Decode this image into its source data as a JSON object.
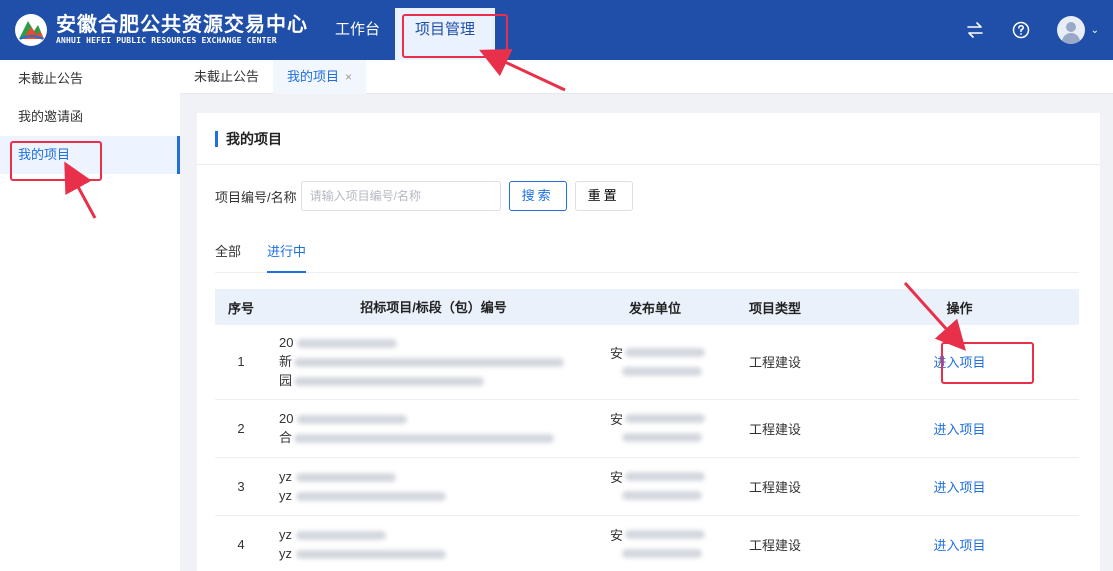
{
  "header": {
    "logo_cn": "安徽合肥公共资源交易中心",
    "logo_en": "ANHUI HEFEI PUBLIC RESOURCES EXCHANGE CENTER",
    "nav": [
      "工作台",
      "项目管理"
    ],
    "active_nav": "项目管理",
    "icons": [
      "swap-icon",
      "help-circle-icon",
      "user-avatar",
      "chevron-down-icon"
    ]
  },
  "sidebar": {
    "items": [
      "未截止公告",
      "我的邀请函",
      "我的项目"
    ],
    "active": "我的项目"
  },
  "tabs": {
    "items": [
      "未截止公告",
      "我的项目"
    ],
    "close_glyph": "×"
  },
  "card": {
    "title": "我的项目",
    "search_label": "项目编号/名称",
    "search_placeholder": "请输入项目编号/名称",
    "search_button": "搜索",
    "reset_button": "重置",
    "filter_tabs": [
      "全部",
      "进行中"
    ],
    "active_filter": "进行中"
  },
  "table": {
    "headers": [
      "序号",
      "招标项目/标段（包）编号",
      "发布单位",
      "项目类型",
      "操作"
    ],
    "rows": [
      {
        "no": "1",
        "name_lines": [
          "20",
          "新",
          "园"
        ],
        "pub": [
          "安"
        ],
        "type": "工程建设",
        "action": "进入项目"
      },
      {
        "no": "2",
        "name_lines": [
          "20",
          "合"
        ],
        "pub": [
          "安"
        ],
        "type": "工程建设",
        "action": "进入项目"
      },
      {
        "no": "3",
        "name_lines": [
          "yz",
          "yz"
        ],
        "pub": [
          "安"
        ],
        "type": "工程建设",
        "action": "进入项目"
      },
      {
        "no": "4",
        "name_lines": [
          "yz",
          "yz"
        ],
        "pub": [
          "安"
        ],
        "type": "工程建设",
        "action": "进入项目"
      }
    ]
  },
  "colors": {
    "header_bg": "#1f4fa8",
    "accent": "#1f6fe0",
    "annotation": "#e8304a"
  }
}
